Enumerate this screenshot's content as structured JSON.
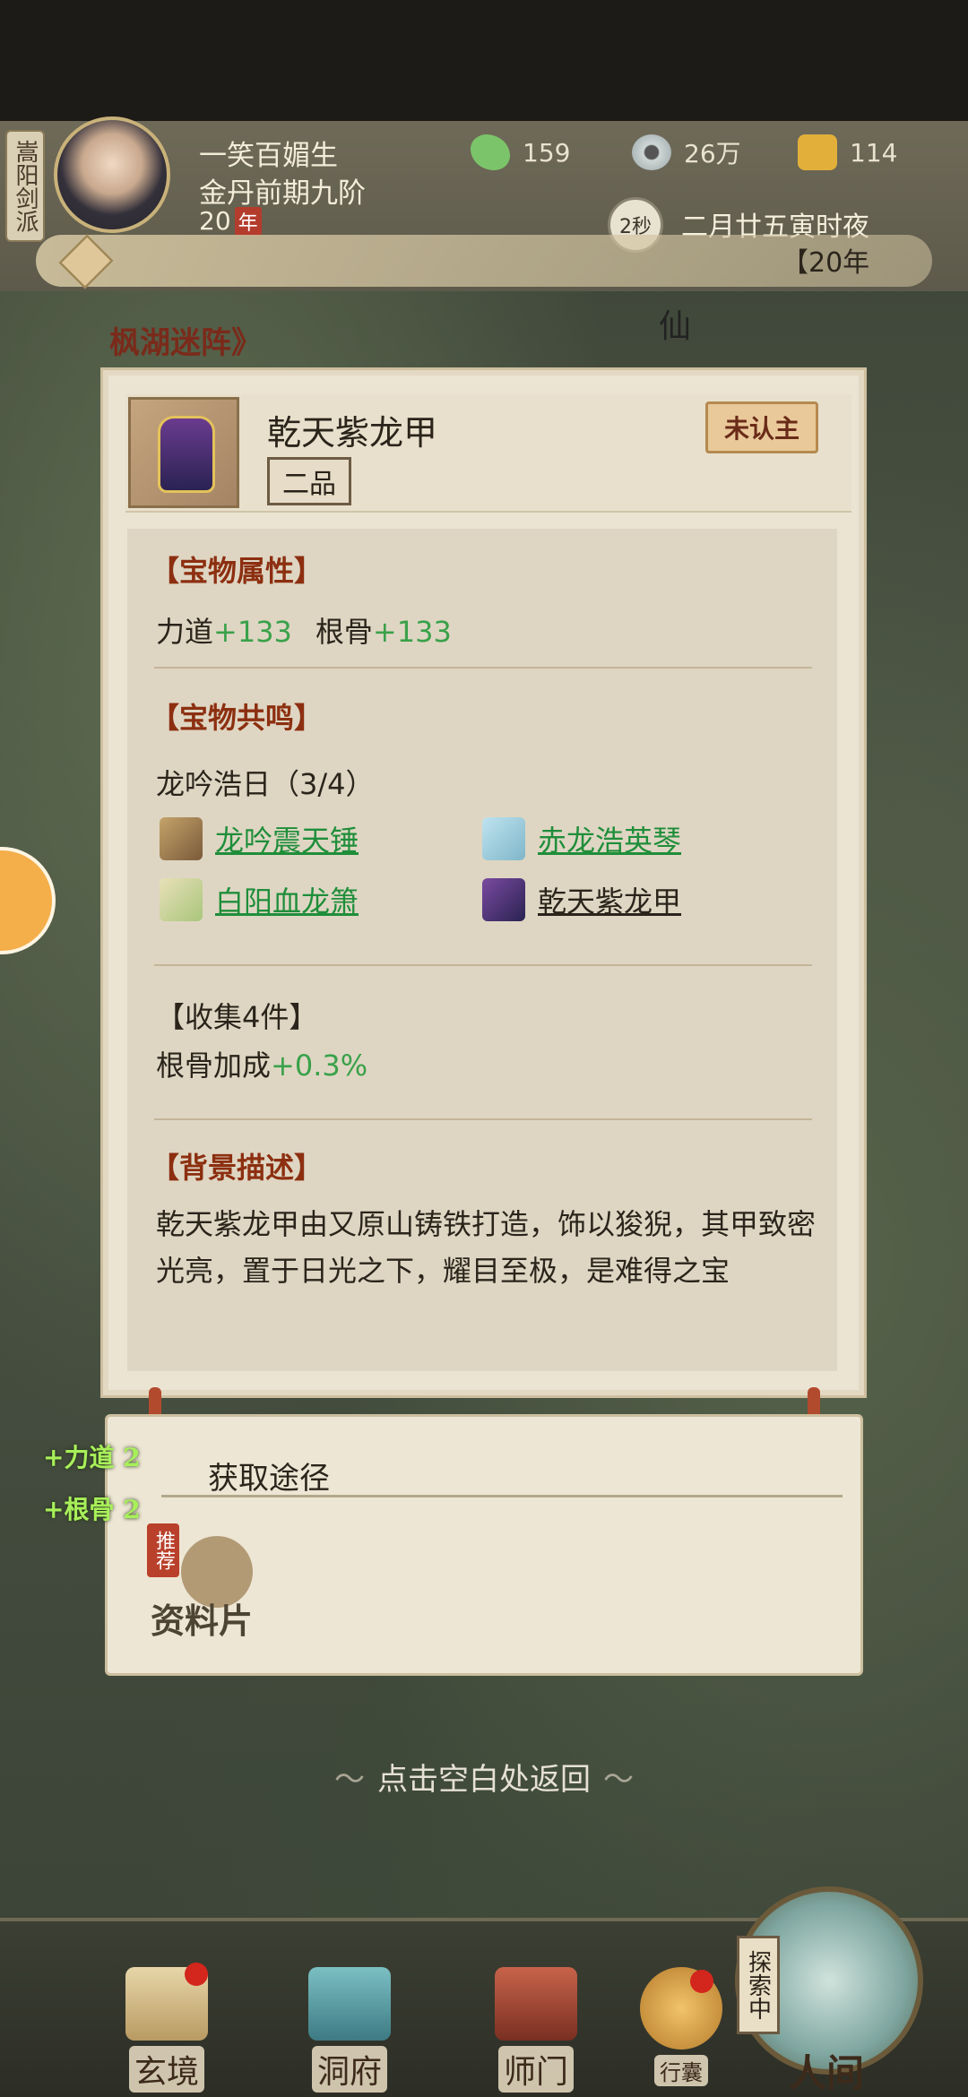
{
  "player": {
    "sect": "嵩阳剑派",
    "name": "一笑百媚生",
    "realm": "金丹前期九阶",
    "age_value": "20",
    "age_unit": "年"
  },
  "resources": {
    "jade": "159",
    "coins": "26万",
    "power": "114"
  },
  "time": {
    "timer": "2秒",
    "date": "二月廿五寅时夜"
  },
  "notice": {
    "text": "【20年"
  },
  "area": {
    "title": "枫湖迷阵》",
    "badge": "仙"
  },
  "item": {
    "name": "乾天紫龙甲",
    "grade": "二品",
    "status": "未认主"
  },
  "attributes": {
    "title": "【宝物属性】",
    "stat1_name": "力道",
    "stat1_value": "+133",
    "stat2_name": "根骨",
    "stat2_value": "+133"
  },
  "resonance": {
    "title": "【宝物共鸣】",
    "set_name": "龙吟浩日（3/4）",
    "items": [
      {
        "name": "龙吟震天锤",
        "icon": "hammer-icon",
        "state": "owned"
      },
      {
        "name": "赤龙浩英琴",
        "icon": "zither-icon",
        "state": "owned"
      },
      {
        "name": "白阳血龙箫",
        "icon": "flute-icon",
        "state": "owned"
      },
      {
        "name": "乾天紫龙甲",
        "icon": "armor-icon",
        "state": "current"
      }
    ]
  },
  "collection": {
    "title": "【收集4件】",
    "bonus_name": "根骨加成",
    "bonus_value": "+0.3%"
  },
  "background": {
    "title": "【背景描述】",
    "text": "乾天紫龙甲由又原山铸铁打造，饰以狻猊，其甲致密光亮，置于日光之下，耀目至极，是难得之宝"
  },
  "obtain": {
    "title": "获取途径",
    "recommend": "推荐",
    "source": "资料片"
  },
  "floating_stats": [
    "+力道 2",
    "+根骨 2"
  ],
  "return_hint": "点击空白处返回",
  "nav": {
    "items": [
      "玄境",
      "洞府",
      "师门",
      "行囊"
    ],
    "explore": "探索中",
    "human": "人间"
  },
  "colors": {
    "green_value": "#3aa14a",
    "section_title": "#8c2f10",
    "badge_red": "#b9402a"
  }
}
